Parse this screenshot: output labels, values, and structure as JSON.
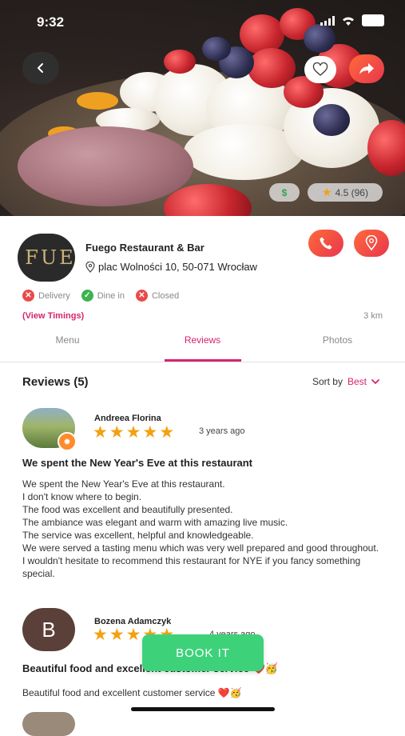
{
  "status": {
    "time": "9:32"
  },
  "hero": {
    "rating": "4.5 (96)",
    "price_icon": "dollar-icon"
  },
  "restaurant": {
    "name": "Fuego Restaurant & Bar",
    "address": "plac Wolności 10, 50-071 Wrocław",
    "logo_text": "FUE",
    "services": [
      {
        "label": "Delivery",
        "available": false
      },
      {
        "label": "Dine in",
        "available": true
      },
      {
        "label": "Closed",
        "available": false
      }
    ],
    "timings_link": "(View Timings)",
    "distance": "3 km"
  },
  "tabs": [
    {
      "label": "Menu",
      "active": false
    },
    {
      "label": "Reviews",
      "active": true
    },
    {
      "label": "Photos",
      "active": false
    }
  ],
  "reviews_section": {
    "title": "Reviews (5)",
    "sort_label": "Sort by",
    "sort_value": "Best"
  },
  "reviews": [
    {
      "author": "Andreea Florina",
      "stars": 5,
      "time": "3 years ago",
      "title": "We spent the New Year's Eve at this restaurant",
      "body": [
        "We spent the New Year's Eve at this restaurant.",
        "I don't know where to begin.",
        "The food was excellent and beautifully presented.",
        "The ambiance was elegant and warm with amazing live music.",
        "The service was excellent, helpful and knowledgeable.",
        "We were served a tasting menu which was very well prepared and good throughout.",
        "I wouldn't hesitate to recommend this restaurant for NYE if you fancy something special."
      ]
    },
    {
      "author": "Bozena Adamczyk",
      "initial": "B",
      "stars": 5,
      "time": "4 years ago",
      "title": "Beautiful food and excellent customer service ❤️🥳",
      "body": [
        "Beautiful food and excellent customer service ❤️🥳"
      ]
    }
  ],
  "book_button": "BOOK IT",
  "colors": {
    "accent": "#d6246c",
    "book": "#3dd27a",
    "star": "#f4a00f"
  }
}
